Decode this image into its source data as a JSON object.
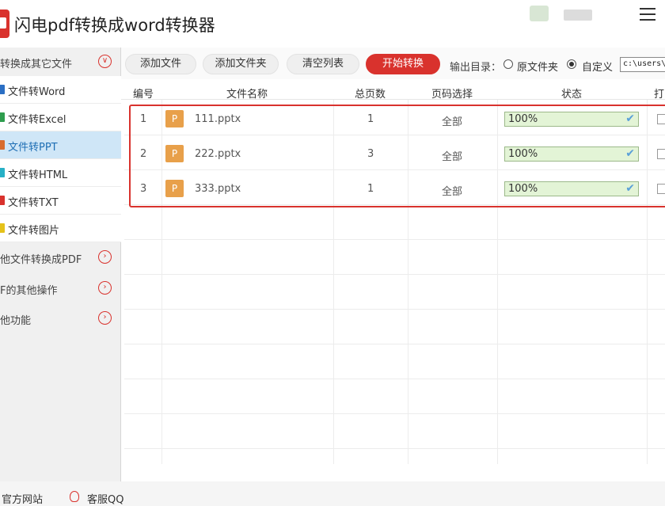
{
  "app": {
    "title": "闪电pdf转换成word转换器"
  },
  "sidebar": {
    "section1": {
      "label": "转换成其它文件",
      "icon": "chevron-down-icon"
    },
    "items": [
      {
        "label": "文件转Word",
        "icon": "word-icon",
        "color": "#2b6fc4"
      },
      {
        "label": "文件转Excel",
        "icon": "excel-icon",
        "color": "#2e9d4e"
      },
      {
        "label": "文件转PPT",
        "icon": "ppt-icon",
        "color": "#d86b2d",
        "active": true
      },
      {
        "label": "文件转HTML",
        "icon": "html-icon",
        "color": "#27b0c6"
      },
      {
        "label": "文件转TXT",
        "icon": "txt-icon",
        "color": "#d9322d"
      },
      {
        "label": "文件转图片",
        "icon": "image-icon",
        "color": "#e5c21a"
      }
    ],
    "section2": {
      "label": "他文件转换成PDF",
      "icon": "chevron-right-icon"
    },
    "section3": {
      "label": "F的其他操作",
      "icon": "chevron-right-icon"
    },
    "section4": {
      "label": "他功能",
      "icon": "chevron-right-icon"
    }
  },
  "toolbar": {
    "add_file": "添加文件",
    "add_folder": "添加文件夹",
    "clear_list": "清空列表",
    "start": "开始转换",
    "output_label": "输出目录：",
    "option_source": "原文件夹",
    "option_custom": "自定义",
    "path_value": "c:\\users\\A"
  },
  "table": {
    "headers": [
      "编号",
      "文件名称",
      "总页数",
      "页码选择",
      "状态",
      "打"
    ],
    "rows": [
      {
        "num": "1",
        "icon": "P",
        "name": "111.pptx",
        "pages": "1",
        "range": "全部",
        "status": "100%",
        "progress": 1.0
      },
      {
        "num": "2",
        "icon": "P",
        "name": "222.pptx",
        "pages": "3",
        "range": "全部",
        "status": "100%",
        "progress": 1.0
      },
      {
        "num": "3",
        "icon": "P",
        "name": "333.pptx",
        "pages": "1",
        "range": "全部",
        "status": "100%",
        "progress": 1.0
      }
    ]
  },
  "footer": {
    "website": "官方网站",
    "support": "客服QQ"
  },
  "colors": {
    "accent": "#d9322d",
    "active_item": "#cfe6f7",
    "progress": "#e3f4d6"
  }
}
